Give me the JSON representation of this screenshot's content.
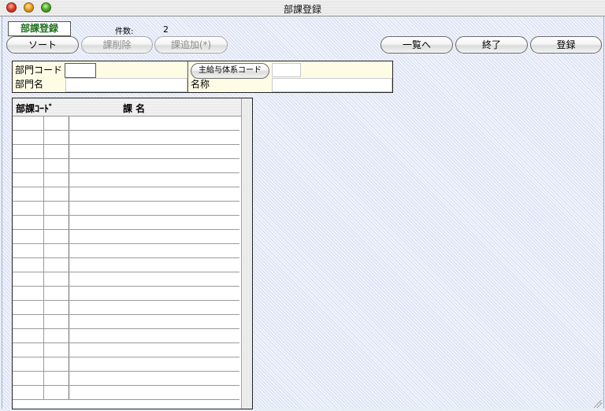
{
  "window": {
    "title": "部課登録"
  },
  "header": {
    "screen_label": "部課登録",
    "count_label": "件数:",
    "count_value": "2"
  },
  "toolbar": {
    "sort_label": "ソート",
    "delete_label": "課削除",
    "add_label": "課追加(*)",
    "list_label": "一覧へ",
    "exit_label": "終了",
    "register_label": "登録"
  },
  "form": {
    "dept_code_label": "部門コード",
    "dept_name_label": "部門名",
    "salary_system_button": "主給与体系コード",
    "name_label": "名称",
    "dept_code_value": "",
    "dept_name_value": "",
    "salary_code_value": "",
    "name_value": ""
  },
  "list": {
    "headers": [
      "部課ｺｰﾄﾞ",
      "課 名"
    ],
    "row_count": 20
  },
  "colors": {
    "screen_label_text": "#1d6f1d",
    "form_background": "#fffce6",
    "content_background": "#f1f4fb"
  }
}
